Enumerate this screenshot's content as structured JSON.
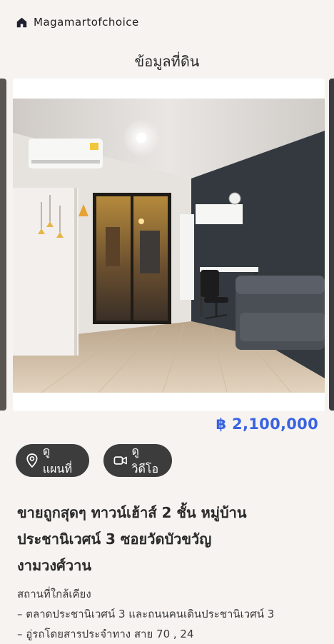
{
  "header": {
    "brand_name": "Magamartofchoice",
    "page_title": "ข้อมูลที่ดิน"
  },
  "listing": {
    "price": "฿ 2,100,000",
    "map_button_label": "ดูแผนที่",
    "video_button_label": "ดูวิดีโอ",
    "title_lines": [
      "ขายถูกสุดๆ ทาวน์เฮ้าส์ 2 ชั้น หมู่บ้าน",
      "ประชานิเวศน์ 3 ซอยวัดบัวขวัญ",
      "งามวงศ์วาน"
    ],
    "nearby_heading": "สถานที่ใกล้เคียง",
    "nearby_items": [
      "– ตลาดประชานิเวศน์ 3 และถนนคนเดินประชานิเวศน์ 3",
      "– อู่รถโดยสารประจำทาง สาย 70 , 24"
    ]
  },
  "colors": {
    "price": "#3a63e0",
    "pill_bg": "#3c3c3c",
    "page_bg": "#f6f3f1"
  },
  "icons": {
    "brand": "home-icon",
    "map": "map-pin-icon",
    "video": "video-camera-icon"
  }
}
